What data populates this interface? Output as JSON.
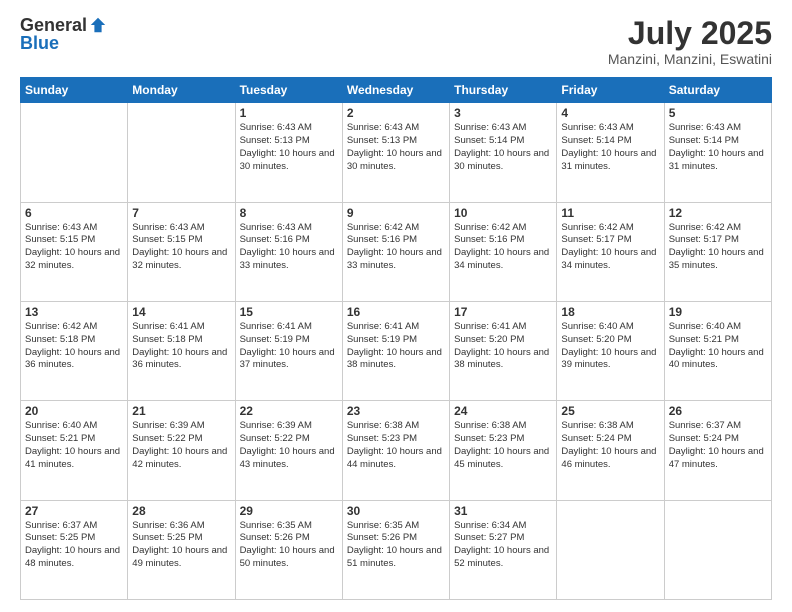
{
  "logo": {
    "general": "General",
    "blue": "Blue"
  },
  "calendar": {
    "title": "July 2025",
    "location": "Manzini, Manzini, Eswatini",
    "days": [
      "Sunday",
      "Monday",
      "Tuesday",
      "Wednesday",
      "Thursday",
      "Friday",
      "Saturday"
    ],
    "weeks": [
      [
        {
          "day": "",
          "text": ""
        },
        {
          "day": "",
          "text": ""
        },
        {
          "day": "1",
          "text": "Sunrise: 6:43 AM\nSunset: 5:13 PM\nDaylight: 10 hours and 30 minutes."
        },
        {
          "day": "2",
          "text": "Sunrise: 6:43 AM\nSunset: 5:13 PM\nDaylight: 10 hours and 30 minutes."
        },
        {
          "day": "3",
          "text": "Sunrise: 6:43 AM\nSunset: 5:14 PM\nDaylight: 10 hours and 30 minutes."
        },
        {
          "day": "4",
          "text": "Sunrise: 6:43 AM\nSunset: 5:14 PM\nDaylight: 10 hours and 31 minutes."
        },
        {
          "day": "5",
          "text": "Sunrise: 6:43 AM\nSunset: 5:14 PM\nDaylight: 10 hours and 31 minutes."
        }
      ],
      [
        {
          "day": "6",
          "text": "Sunrise: 6:43 AM\nSunset: 5:15 PM\nDaylight: 10 hours and 32 minutes."
        },
        {
          "day": "7",
          "text": "Sunrise: 6:43 AM\nSunset: 5:15 PM\nDaylight: 10 hours and 32 minutes."
        },
        {
          "day": "8",
          "text": "Sunrise: 6:43 AM\nSunset: 5:16 PM\nDaylight: 10 hours and 33 minutes."
        },
        {
          "day": "9",
          "text": "Sunrise: 6:42 AM\nSunset: 5:16 PM\nDaylight: 10 hours and 33 minutes."
        },
        {
          "day": "10",
          "text": "Sunrise: 6:42 AM\nSunset: 5:16 PM\nDaylight: 10 hours and 34 minutes."
        },
        {
          "day": "11",
          "text": "Sunrise: 6:42 AM\nSunset: 5:17 PM\nDaylight: 10 hours and 34 minutes."
        },
        {
          "day": "12",
          "text": "Sunrise: 6:42 AM\nSunset: 5:17 PM\nDaylight: 10 hours and 35 minutes."
        }
      ],
      [
        {
          "day": "13",
          "text": "Sunrise: 6:42 AM\nSunset: 5:18 PM\nDaylight: 10 hours and 36 minutes."
        },
        {
          "day": "14",
          "text": "Sunrise: 6:41 AM\nSunset: 5:18 PM\nDaylight: 10 hours and 36 minutes."
        },
        {
          "day": "15",
          "text": "Sunrise: 6:41 AM\nSunset: 5:19 PM\nDaylight: 10 hours and 37 minutes."
        },
        {
          "day": "16",
          "text": "Sunrise: 6:41 AM\nSunset: 5:19 PM\nDaylight: 10 hours and 38 minutes."
        },
        {
          "day": "17",
          "text": "Sunrise: 6:41 AM\nSunset: 5:20 PM\nDaylight: 10 hours and 38 minutes."
        },
        {
          "day": "18",
          "text": "Sunrise: 6:40 AM\nSunset: 5:20 PM\nDaylight: 10 hours and 39 minutes."
        },
        {
          "day": "19",
          "text": "Sunrise: 6:40 AM\nSunset: 5:21 PM\nDaylight: 10 hours and 40 minutes."
        }
      ],
      [
        {
          "day": "20",
          "text": "Sunrise: 6:40 AM\nSunset: 5:21 PM\nDaylight: 10 hours and 41 minutes."
        },
        {
          "day": "21",
          "text": "Sunrise: 6:39 AM\nSunset: 5:22 PM\nDaylight: 10 hours and 42 minutes."
        },
        {
          "day": "22",
          "text": "Sunrise: 6:39 AM\nSunset: 5:22 PM\nDaylight: 10 hours and 43 minutes."
        },
        {
          "day": "23",
          "text": "Sunrise: 6:38 AM\nSunset: 5:23 PM\nDaylight: 10 hours and 44 minutes."
        },
        {
          "day": "24",
          "text": "Sunrise: 6:38 AM\nSunset: 5:23 PM\nDaylight: 10 hours and 45 minutes."
        },
        {
          "day": "25",
          "text": "Sunrise: 6:38 AM\nSunset: 5:24 PM\nDaylight: 10 hours and 46 minutes."
        },
        {
          "day": "26",
          "text": "Sunrise: 6:37 AM\nSunset: 5:24 PM\nDaylight: 10 hours and 47 minutes."
        }
      ],
      [
        {
          "day": "27",
          "text": "Sunrise: 6:37 AM\nSunset: 5:25 PM\nDaylight: 10 hours and 48 minutes."
        },
        {
          "day": "28",
          "text": "Sunrise: 6:36 AM\nSunset: 5:25 PM\nDaylight: 10 hours and 49 minutes."
        },
        {
          "day": "29",
          "text": "Sunrise: 6:35 AM\nSunset: 5:26 PM\nDaylight: 10 hours and 50 minutes."
        },
        {
          "day": "30",
          "text": "Sunrise: 6:35 AM\nSunset: 5:26 PM\nDaylight: 10 hours and 51 minutes."
        },
        {
          "day": "31",
          "text": "Sunrise: 6:34 AM\nSunset: 5:27 PM\nDaylight: 10 hours and 52 minutes."
        },
        {
          "day": "",
          "text": ""
        },
        {
          "day": "",
          "text": ""
        }
      ]
    ]
  }
}
